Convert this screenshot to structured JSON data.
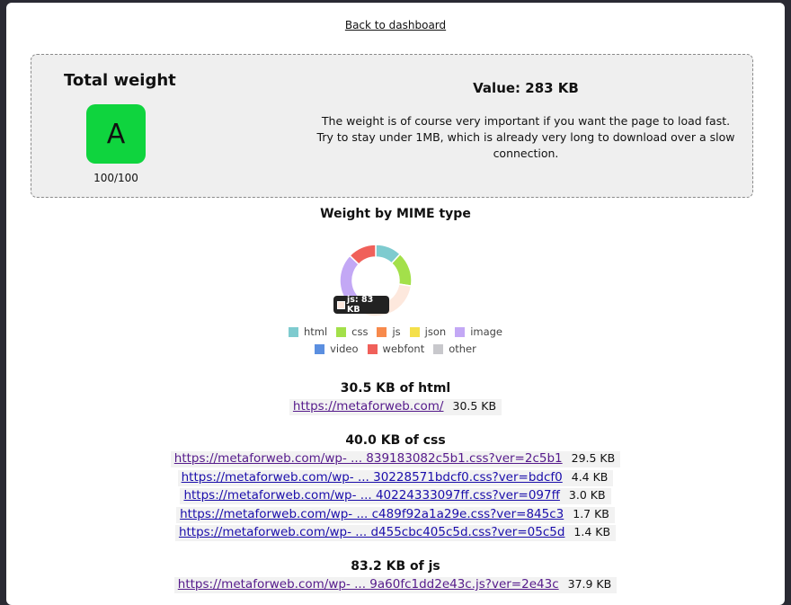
{
  "nav": {
    "back_label": "Back to dashboard"
  },
  "summary": {
    "title": "Total weight",
    "grade": "A",
    "score": "100/100",
    "value": "Value: 283 KB",
    "description": "The weight is of course very important if you want the page to load fast. Try to stay under 1MB, which is already very long to download over a slow connection."
  },
  "mime_chart": {
    "title": "Weight by MIME type",
    "tooltip": "js: 83 KB",
    "legend_row1": [
      {
        "label": "html",
        "color": "#7ecbcf"
      },
      {
        "label": "css",
        "color": "#a3e04a"
      },
      {
        "label": "js",
        "color": "#f78a4c"
      },
      {
        "label": "json",
        "color": "#f4e04a"
      },
      {
        "label": "image",
        "color": "#c3a8f5"
      }
    ],
    "legend_row2": [
      {
        "label": "video",
        "color": "#5b8fe0"
      },
      {
        "label": "webfont",
        "color": "#f0605a"
      },
      {
        "label": "other",
        "color": "#c8c8cc"
      }
    ]
  },
  "chart_data": {
    "type": "pie",
    "title": "Weight by MIME type",
    "unit": "KB",
    "categories": [
      "html",
      "css",
      "js",
      "json",
      "image",
      "video",
      "webfont",
      "other"
    ],
    "values": [
      30.5,
      40.0,
      83.2,
      0,
      70,
      0,
      33,
      0
    ],
    "colors": [
      "#7ecbcf",
      "#a3e04a",
      "#fde8dd",
      "#f4e04a",
      "#c3a8f5",
      "#5b8fe0",
      "#f0605a",
      "#c8c8cc"
    ],
    "legend": "bottom"
  },
  "html_section": {
    "title": "30.5 KB of html",
    "rows": [
      {
        "url": "https://metaforweb.com/",
        "size": "30.5 KB"
      }
    ]
  },
  "css_section": {
    "title": "40.0 KB of css",
    "rows": [
      {
        "url": "https://metaforweb.com/wp- ... 839183082c5b1.css?ver=2c5b1",
        "size": "29.5 KB"
      },
      {
        "url": "https://metaforweb.com/wp- ... 30228571bdcf0.css?ver=bdcf0",
        "size": "4.4 KB"
      },
      {
        "url": "https://metaforweb.com/wp- ... 40224333097ff.css?ver=097ff",
        "size": "3.0 KB"
      },
      {
        "url": "https://metaforweb.com/wp- ... c489f92a1a29e.css?ver=845c3",
        "size": "1.7 KB"
      },
      {
        "url": "https://metaforweb.com/wp- ... d455cbc405c5d.css?ver=05c5d",
        "size": "1.4 KB"
      }
    ]
  },
  "js_section": {
    "title": "83.2 KB of js",
    "rows": [
      {
        "url": "https://metaforweb.com/wp- ... 9a60fc1dd2e43c.js?ver=2e43c",
        "size": "37.9 KB"
      }
    ]
  }
}
